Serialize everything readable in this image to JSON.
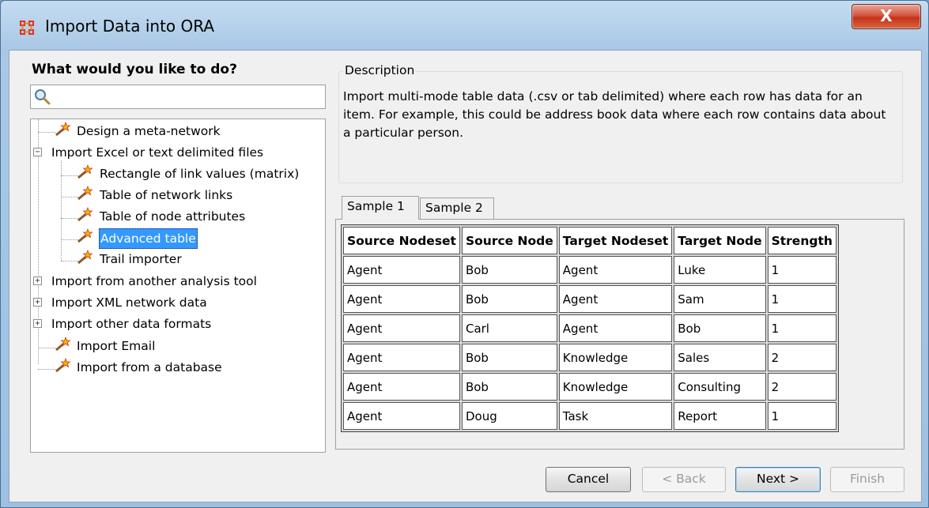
{
  "window": {
    "title": "Import Data into ORA",
    "close_label": "X"
  },
  "left": {
    "heading": "What would you like to do?",
    "search": {
      "value": "",
      "placeholder": ""
    },
    "tree": [
      {
        "label": "Design a meta-network",
        "selected": false
      },
      {
        "label": "Import Excel or text delimited files",
        "expanded": true
      },
      {
        "label": "Rectangle of link values (matrix)"
      },
      {
        "label": "Table of network links"
      },
      {
        "label": "Table of node attributes"
      },
      {
        "label": "Advanced table",
        "selected": true
      },
      {
        "label": "Trail importer"
      },
      {
        "label": "Import from another analysis tool",
        "expanded": false
      },
      {
        "label": "Import XML network data",
        "expanded": false
      },
      {
        "label": "Import other data formats",
        "expanded": false
      },
      {
        "label": "Import Email"
      },
      {
        "label": "Import from a database"
      }
    ]
  },
  "description": {
    "legend": "Description",
    "text": "Import multi-mode table data (.csv or tab delimited) where each row has data for an item. For example, this could be address book data where each row contains data about a particular person."
  },
  "tabs": [
    {
      "label": "Sample 1",
      "active": true
    },
    {
      "label": "Sample 2",
      "active": false
    }
  ],
  "sample_table": {
    "headers": [
      "Source Nodeset",
      "Source Node",
      "Target Nodeset",
      "Target Node",
      "Strength"
    ],
    "rows": [
      [
        "Agent",
        "Bob",
        "Agent",
        "Luke",
        "1"
      ],
      [
        "Agent",
        "Bob",
        "Agent",
        "Sam",
        "1"
      ],
      [
        "Agent",
        "Carl",
        "Agent",
        "Bob",
        "1"
      ],
      [
        "Agent",
        "Bob",
        "Knowledge",
        "Sales",
        "2"
      ],
      [
        "Agent",
        "Bob",
        "Knowledge",
        "Consulting",
        "2"
      ],
      [
        "Agent",
        "Doug",
        "Task",
        "Report",
        "1"
      ]
    ]
  },
  "buttons": {
    "cancel": "Cancel",
    "back": "< Back",
    "next": "Next >",
    "finish": "Finish"
  },
  "icons": {
    "app": "network-grid-icon",
    "search": "magnifier-icon",
    "tree_item": "magic-wand-icon"
  },
  "colors": {
    "selection": "#3399ff",
    "close_button": "#c4331a"
  }
}
